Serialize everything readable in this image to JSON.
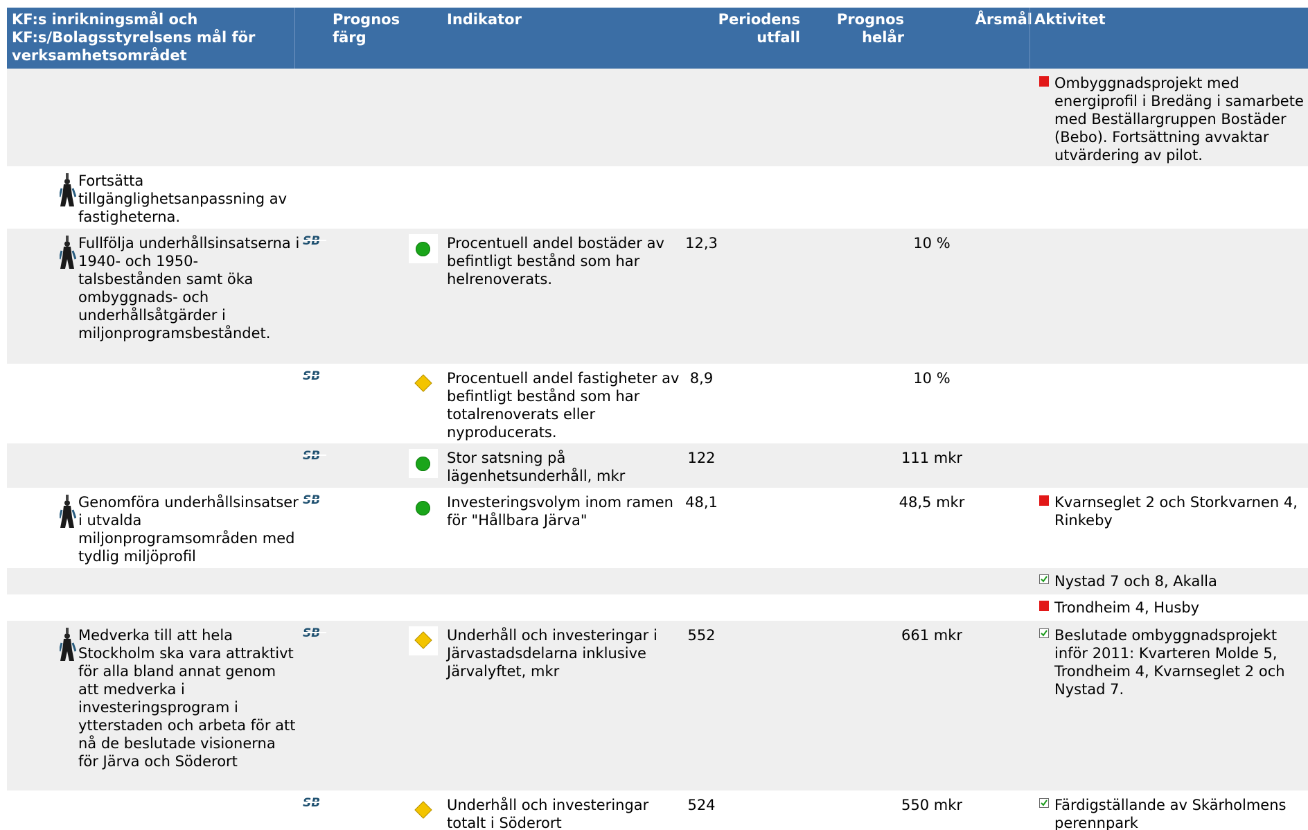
{
  "header": {
    "goal": "KF:s inrikningsmål och KF:s/Bolagsstyrelsens mål för verksamhetsområdet",
    "prognos_farg": "Prognos färg",
    "indikator": "Indikator",
    "periodens_utfall": "Periodens utfall",
    "prognos_helar": "Prognos helår",
    "arsmal": "Årsmål",
    "aktivitet": "Aktivitet"
  },
  "colors": {
    "header_bg": "#3b6ea5",
    "row_alt": "#efefef",
    "green": "#1aa51a",
    "yellow": "#f3c400",
    "red": "#e21818"
  },
  "rows": [
    {
      "activity": "Ombyggnadsprojekt med energiprofil i Bredäng i samarbete med Beställargruppen Bostäder (Bebo). Fortsättning avvaktar utvärdering av pilot.",
      "activity_icon": "red-square"
    },
    {
      "goal": "Fortsätta tillgänglighetsanpassning av fastigheterna."
    },
    {
      "goal": "Fullfölja underhållsinsatserna i 1940- och 1950-talsbestånden samt öka ombyggnads- och underhållsåtgärder i miljonprogramsbeståndet.",
      "status": "green",
      "indicator": "Procentuell andel bostäder av befintligt bestånd som har helrenoverats.",
      "utfall": "12,3",
      "arsmal": "10 %"
    },
    {
      "status": "yellow",
      "indicator": "Procentuell andel fastigheter av befintligt bestånd som har totalrenoverats eller nyproducerats.",
      "utfall": "8,9",
      "arsmal": "10 %"
    },
    {
      "status": "green",
      "indicator": "Stor satsning på lägenhetsunderhåll, mkr",
      "utfall": "122",
      "arsmal": "111 mkr"
    },
    {
      "goal": "Genomföra underhållsinsatser i utvalda miljonprogramsområden med tydlig miljöprofil",
      "status": "green",
      "indicator": "Investeringsvolym inom ramen för \"Hållbara Järva\"",
      "utfall": "48,1",
      "arsmal": "48,5 mkr",
      "activity": "Kvarnseglet 2 och Storkvarnen 4, Rinkeby",
      "activity_icon": "red-square"
    },
    {
      "activity": "Nystad 7 och 8, Akalla",
      "activity_icon": "checkbox"
    },
    {
      "activity": "Trondheim 4, Husby",
      "activity_icon": "red-square"
    },
    {
      "goal": "Medverka till att hela Stockholm ska vara attraktivt för alla bland annat genom att medverka i investeringsprogram i ytterstaden och arbeta för att nå de beslutade visionerna för Järva och Söderort",
      "status": "yellow",
      "indicator": "Underhåll och investeringar i Järvastadsdelarna inklusive Järvalyftet, mkr",
      "utfall": "552",
      "arsmal": "661 mkr",
      "activity": "Beslutade ombyggnadsprojekt inför 2011: Kvarteren Molde 5, Trondheim 4, Kvarnseglet 2 och Nystad 7.",
      "activity_icon": "checkbox"
    },
    {
      "status": "yellow",
      "indicator": "Underhåll och investeringar totalt i Söderort",
      "utfall": "524",
      "arsmal": "550 mkr",
      "activity": "Färdigställande av Skärholmens perennpark",
      "activity_icon": "checkbox"
    }
  ]
}
